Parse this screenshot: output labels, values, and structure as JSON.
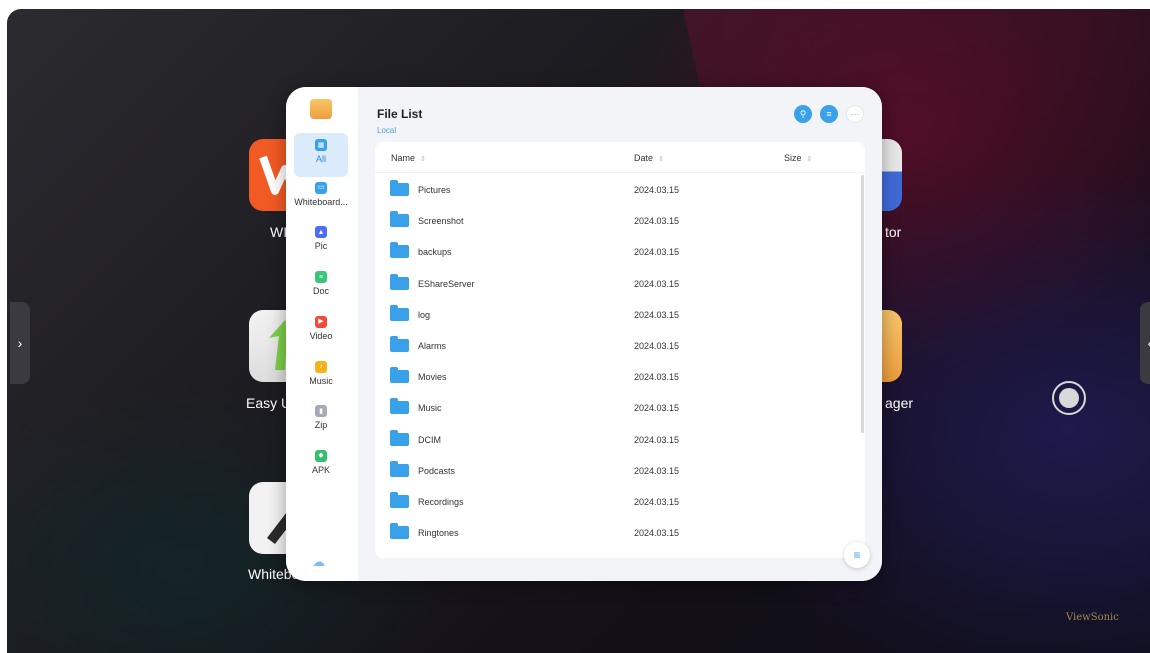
{
  "desktop": {
    "apps": [
      {
        "label": "WI",
        "icon": "wps-office-icon"
      },
      {
        "label": "Easy U",
        "icon": "easy-update-icon"
      },
      {
        "label": "Whitebo",
        "icon": "whiteboard-pen-icon"
      },
      {
        "label": "tor",
        "icon": "app-tor-icon"
      },
      {
        "label": "ager",
        "icon": "file-manager-icon"
      }
    ],
    "left_handle": "›",
    "right_handle": "‹",
    "brand": "ViewSonic"
  },
  "filemanager": {
    "title": "File List",
    "breadcrumb": "Local",
    "categories": [
      {
        "label": "All",
        "icon": "grid-icon",
        "color": "#39a0ea",
        "glyph": "▦"
      },
      {
        "label": "Whiteboard...",
        "icon": "whiteboard-icon",
        "color": "#39a0ea",
        "glyph": "▭"
      },
      {
        "label": "Pic",
        "icon": "picture-icon",
        "color": "#4c6ef5",
        "glyph": "▲"
      },
      {
        "label": "Doc",
        "icon": "document-icon",
        "color": "#3bc47a",
        "glyph": "≡"
      },
      {
        "label": "Video",
        "icon": "video-icon",
        "color": "#f04a3a",
        "glyph": "▶"
      },
      {
        "label": "Music",
        "icon": "music-icon",
        "color": "#f6b21b",
        "glyph": "♪"
      },
      {
        "label": "Zip",
        "icon": "zip-icon",
        "color": "#a3aab3",
        "glyph": "▮"
      },
      {
        "label": "APK",
        "icon": "android-icon",
        "color": "#2ec26a",
        "glyph": "◆"
      }
    ],
    "columns": {
      "name": "Name",
      "date": "Date",
      "size": "Size"
    },
    "rows": [
      {
        "name": "Pictures",
        "date": "2024.03.15"
      },
      {
        "name": "Screenshot",
        "date": "2024.03.15"
      },
      {
        "name": "backups",
        "date": "2024.03.15"
      },
      {
        "name": "EShareServer",
        "date": "2024.03.15"
      },
      {
        "name": "log",
        "date": "2024.03.15"
      },
      {
        "name": "Alarms",
        "date": "2024.03.15"
      },
      {
        "name": "Movies",
        "date": "2024.03.15"
      },
      {
        "name": "Music",
        "date": "2024.03.15"
      },
      {
        "name": "DCIM",
        "date": "2024.03.15"
      },
      {
        "name": "Podcasts",
        "date": "2024.03.15"
      },
      {
        "name": "Recordings",
        "date": "2024.03.15"
      },
      {
        "name": "Ringtones",
        "date": "2024.03.15"
      }
    ],
    "accent_color": "#39a0ea"
  }
}
